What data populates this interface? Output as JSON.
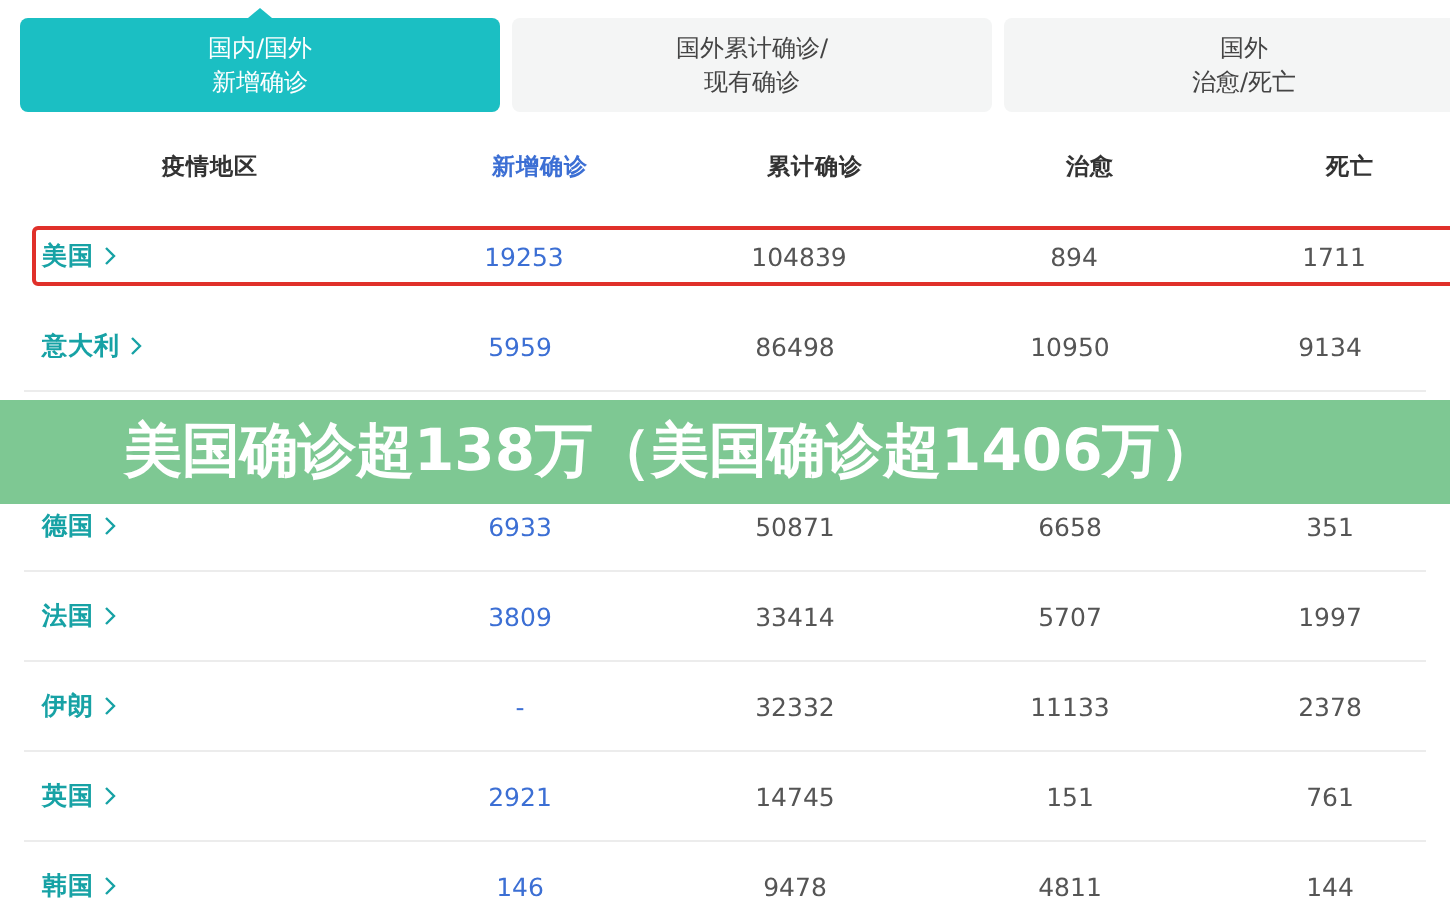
{
  "tabs": [
    {
      "lines": [
        "国内/国外",
        "新增确诊"
      ],
      "selected": true
    },
    {
      "lines": [
        "国外累计确诊/",
        "现有确诊"
      ],
      "selected": false
    },
    {
      "lines": [
        "国外",
        "治愈/死亡"
      ],
      "selected": false
    }
  ],
  "columns": [
    {
      "label": "疫情地区",
      "selected": false
    },
    {
      "label": "新增确诊",
      "selected": true
    },
    {
      "label": "累计确诊",
      "selected": false
    },
    {
      "label": "治愈",
      "selected": false
    },
    {
      "label": "死亡",
      "selected": false
    }
  ],
  "rows": [
    {
      "kind": "data",
      "region": "美国",
      "new": "19253",
      "total": "104839",
      "cured": "894",
      "deaths": "1711",
      "highlighted": true
    },
    {
      "kind": "data",
      "region": "意大利",
      "new": "5959",
      "total": "86498",
      "cured": "10950",
      "deaths": "9134",
      "highlighted": false
    },
    {
      "kind": "banner",
      "title": "美国确诊超138万（美国确诊超1406万）"
    },
    {
      "kind": "data",
      "region": "德国",
      "new": "6933",
      "total": "50871",
      "cured": "6658",
      "deaths": "351",
      "highlighted": false
    },
    {
      "kind": "data",
      "region": "法国",
      "new": "3809",
      "total": "33414",
      "cured": "5707",
      "deaths": "1997",
      "highlighted": false
    },
    {
      "kind": "data",
      "region": "伊朗",
      "new": "-",
      "total": "32332",
      "cured": "11133",
      "deaths": "2378",
      "highlighted": false
    },
    {
      "kind": "data",
      "region": "英国",
      "new": "2921",
      "total": "14745",
      "cured": "151",
      "deaths": "761",
      "highlighted": false
    },
    {
      "kind": "data",
      "region": "韩国",
      "new": "146",
      "total": "9478",
      "cured": "4811",
      "deaths": "144",
      "highlighted": false
    }
  ]
}
